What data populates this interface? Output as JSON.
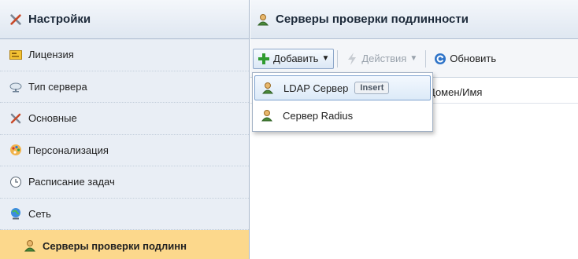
{
  "sidebar": {
    "title": "Настройки",
    "items": [
      {
        "label": "Лицензия",
        "icon": "license-icon"
      },
      {
        "label": "Тип сервера",
        "icon": "server-type-icon"
      },
      {
        "label": "Основные",
        "icon": "settings-tools-icon"
      },
      {
        "label": "Персонализация",
        "icon": "palette-icon"
      },
      {
        "label": "Расписание задач",
        "icon": "clock-icon"
      },
      {
        "label": "Сеть",
        "icon": "network-globe-icon"
      },
      {
        "label": "Серверы проверки подлинн",
        "icon": "user-icon",
        "selected": true
      }
    ]
  },
  "main": {
    "title": "Серверы проверки подлинности",
    "toolbar": {
      "add_label": "Добавить",
      "actions_label": "Действия",
      "refresh_label": "Обновить"
    },
    "grid": {
      "columns": [
        "Домен/Имя"
      ]
    }
  },
  "add_menu": {
    "items": [
      {
        "label": "LDAP Сервер",
        "shortcut": "Insert",
        "highlighted": true
      },
      {
        "label": "Сервер Radius"
      }
    ]
  },
  "colors": {
    "sidebar_bg": "#e9eef5",
    "selected_item": "#fcd88c",
    "accent_green": "#2f9b2f",
    "refresh_blue": "#2f74c8"
  }
}
